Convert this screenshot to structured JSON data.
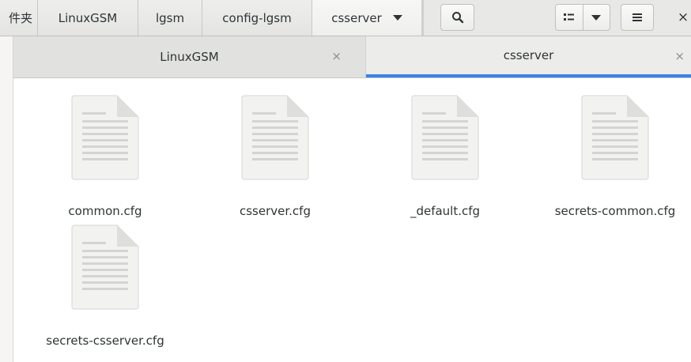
{
  "breadcrumbs": [
    {
      "label": "件夹"
    },
    {
      "label": "LinuxGSM"
    },
    {
      "label": "lgsm"
    },
    {
      "label": "config-lgsm"
    },
    {
      "label": "csserver"
    }
  ],
  "header": {
    "search_icon": "search-icon",
    "view_icon": "list-view-icon",
    "view_options_icon": "chevron-down-icon",
    "menu_icon": "hamburger-menu-icon",
    "close_label": "×"
  },
  "tabs": [
    {
      "label": "LinuxGSM",
      "close": "×"
    },
    {
      "label": "csserver",
      "close": "×",
      "active": true
    }
  ],
  "files": [
    {
      "name": "common.cfg"
    },
    {
      "name": "csserver.cfg"
    },
    {
      "name": "_default.cfg"
    },
    {
      "name": "secrets-common.cfg"
    },
    {
      "name": "secrets-csserver.cfg"
    }
  ],
  "colors": {
    "accent": "#3584e4",
    "file_icon": "#f2f2f1"
  }
}
